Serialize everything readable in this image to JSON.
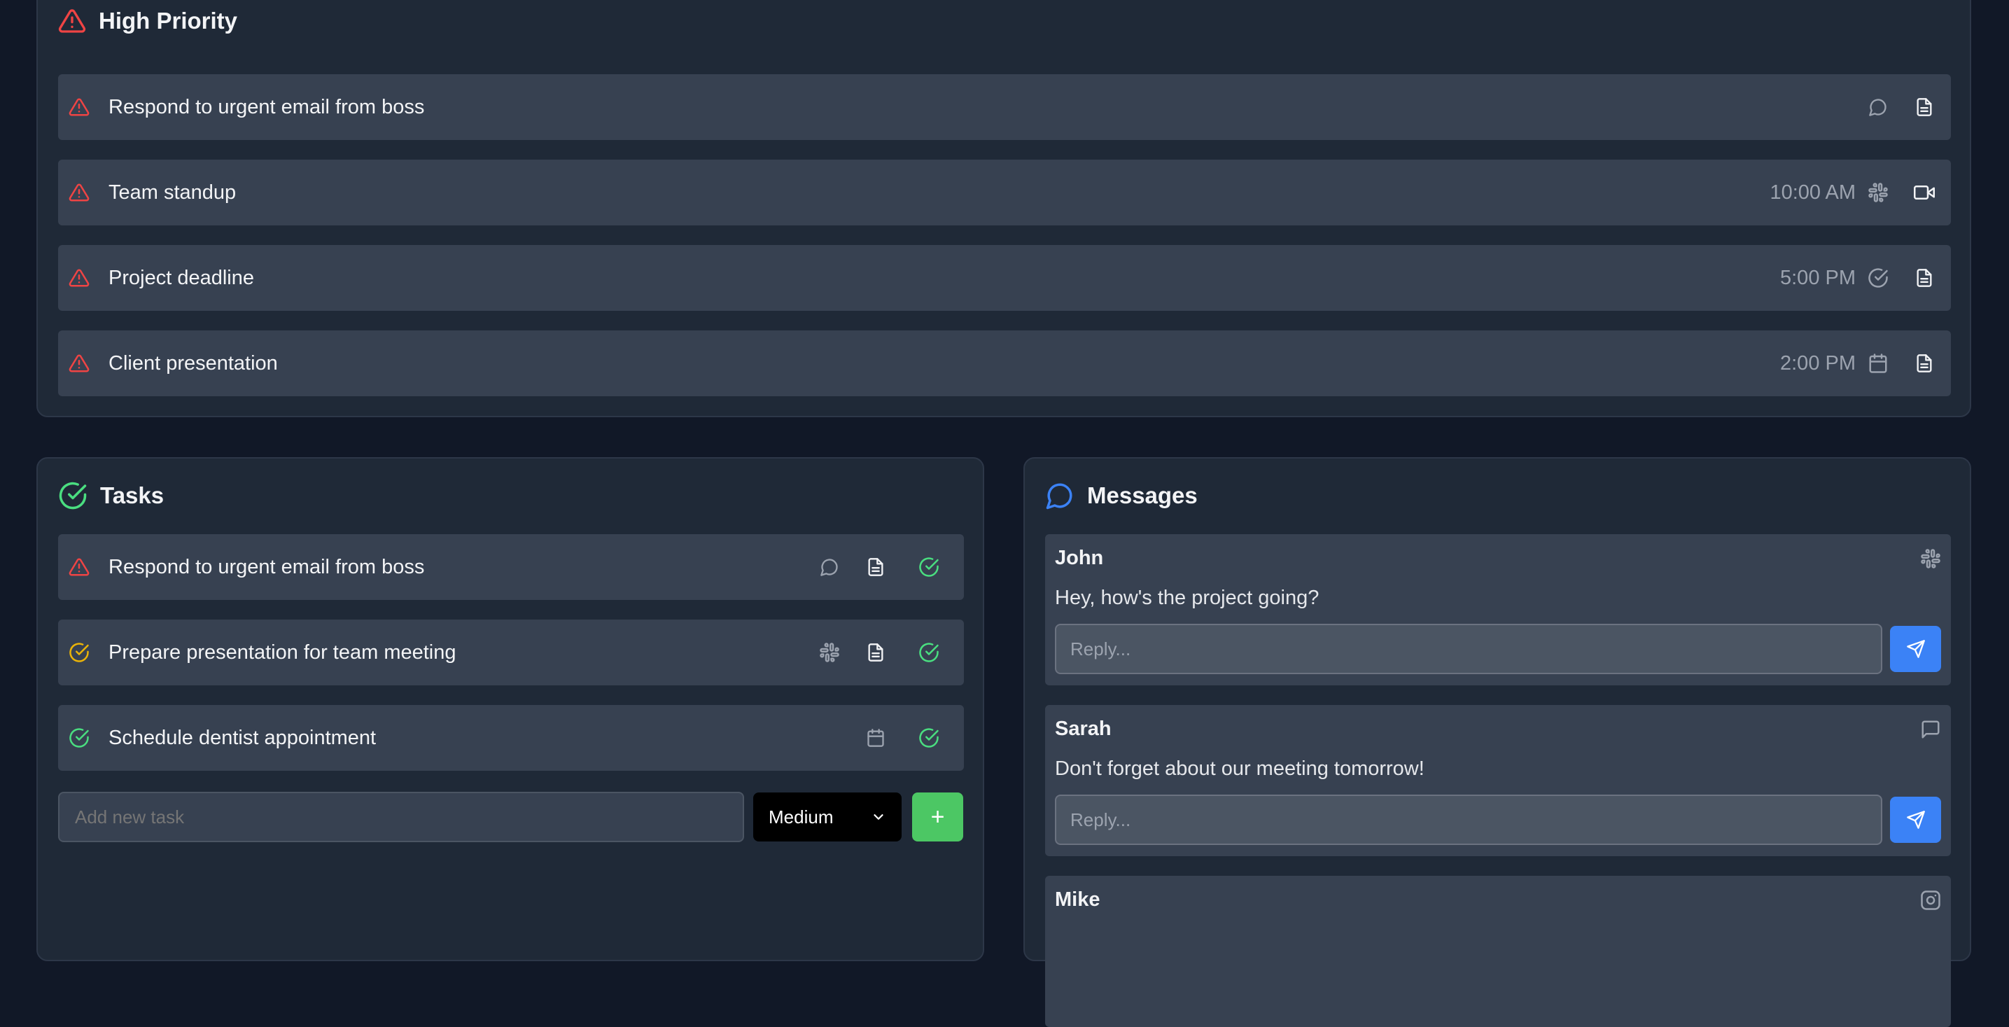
{
  "high_priority": {
    "title": "High Priority",
    "items": [
      {
        "text": "Respond to urgent email from boss",
        "time": "",
        "source_icon": "message-circle-icon",
        "action_icon": "file-text-icon"
      },
      {
        "text": "Team standup",
        "time": "10:00 AM",
        "source_icon": "slack-icon",
        "action_icon": "video-icon"
      },
      {
        "text": "Project deadline",
        "time": "5:00 PM",
        "source_icon": "check-circle-icon",
        "action_icon": "file-text-icon"
      },
      {
        "text": "Client presentation",
        "time": "2:00 PM",
        "source_icon": "calendar-icon",
        "action_icon": "file-text-icon"
      }
    ]
  },
  "tasks": {
    "title": "Tasks",
    "items": [
      {
        "text": "Respond to urgent email from boss",
        "priority": "high"
      },
      {
        "text": "Prepare presentation for team meeting",
        "priority": "medium"
      },
      {
        "text": "Schedule dentist appointment",
        "priority": "low"
      }
    ],
    "new_task_placeholder": "Add new task",
    "priority_select": "Medium",
    "add_label": "+"
  },
  "messages": {
    "title": "Messages",
    "reply_placeholder": "Reply...",
    "items": [
      {
        "name": "John",
        "body": "Hey, how's the project going?",
        "source_icon": "slack-icon"
      },
      {
        "name": "Sarah",
        "body": "Don't forget about our meeting tomorrow!",
        "source_icon": "message-square-icon"
      },
      {
        "name": "Mike",
        "body": "",
        "source_icon": "instagram-icon"
      }
    ]
  },
  "colors": {
    "background": "#111827",
    "card": "#1f2937",
    "row": "#374151",
    "danger": "#ef4444",
    "warning": "#eab308",
    "success": "#4ade80",
    "accent": "#3b82f6"
  }
}
